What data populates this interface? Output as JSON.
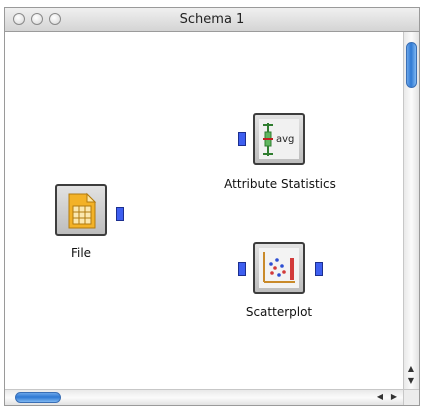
{
  "window": {
    "title": "Schema 1"
  },
  "widgets": {
    "file": {
      "label": "File",
      "icon": "file-table-icon"
    },
    "attribute_statistics": {
      "label": "Attribute Statistics",
      "icon": "attribute-statistics-avg-icon",
      "icon_text": "avg"
    },
    "scatterplot": {
      "label": "Scatterplot",
      "icon": "scatterplot-icon"
    }
  },
  "colors": {
    "port": "#3e5ff0",
    "scroll_thumb": "#2f79d3"
  }
}
